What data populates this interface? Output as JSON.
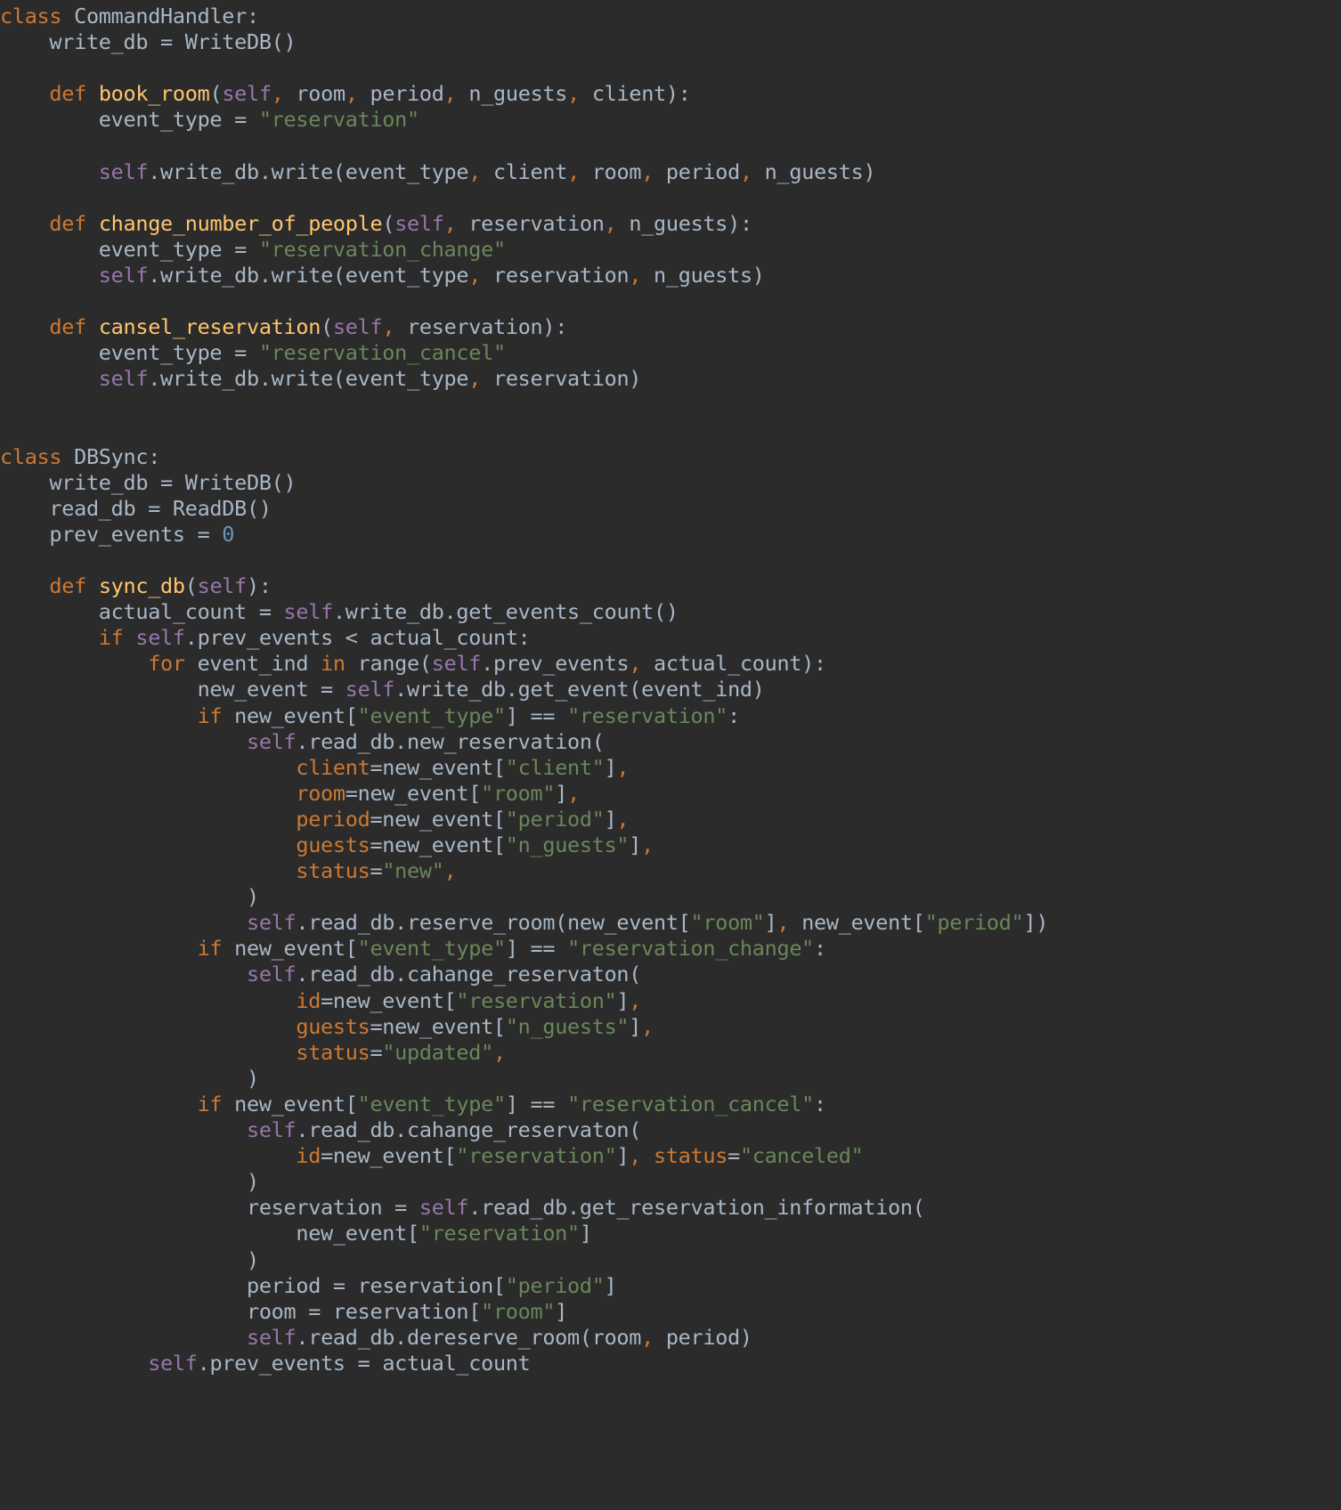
{
  "view": {
    "kind": "code-snippet",
    "language": "Python",
    "background": "#2b2b2b",
    "foreground": "#a9b7c6"
  },
  "theme": {
    "keyword": "#cc7832",
    "function": "#ffc66d",
    "self": "#9876aa",
    "string": "#6a8759",
    "number": "#6897bb",
    "default": "#a9b7c6"
  },
  "code": {
    "text": "class CommandHandler:\n    write_db = WriteDB()\n\n    def book_room(self, room, period, n_guests, client):\n        event_type = \"reservation\"\n\n        self.write_db.write(event_type, client, room, period, n_guests)\n\n    def change_number_of_people(self, reservation, n_guests):\n        event_type = \"reservation_change\"\n        self.write_db.write(event_type, reservation, n_guests)\n\n    def cansel_reservation(self, reservation):\n        event_type = \"reservation_cancel\"\n        self.write_db.write(event_type, reservation)\n\n\nclass DBSync:\n    write_db = WriteDB()\n    read_db = ReadDB()\n    prev_events = 0\n\n    def sync_db(self):\n        actual_count = self.write_db.get_events_count()\n        if self.prev_events < actual_count:\n            for event_ind in range(self.prev_events, actual_count):\n                new_event = self.write_db.get_event(event_ind)\n                if new_event[\"event_type\"] == \"reservation\":\n                    self.read_db.new_reservation(\n                        client=new_event[\"client\"],\n                        room=new_event[\"room\"],\n                        period=new_event[\"period\"],\n                        guests=new_event[\"n_guests\"],\n                        status=\"new\",\n                    )\n                    self.read_db.reserve_room(new_event[\"room\"], new_event[\"period\"])\n                if new_event[\"event_type\"] == \"reservation_change\":\n                    self.read_db.cahange_reservaton(\n                        id=new_event[\"reservation\"],\n                        guests=new_event[\"n_guests\"],\n                        status=\"updated\",\n                    )\n                if new_event[\"event_type\"] == \"reservation_cancel\":\n                    self.read_db.cahange_reservaton(\n                        id=new_event[\"reservation\"], status=\"canceled\"\n                    )\n                    reservation = self.read_db.get_reservation_information(\n                        new_event[\"reservation\"]\n                    )\n                    period = reservation[\"period\"]\n                    room = reservation[\"room\"]\n                    self.read_db.dereserve_room(room, period)\n            self.prev_events = actual_count",
    "classes": [
      "CommandHandler",
      "DBSync"
    ],
    "methods": [
      "book_room",
      "change_number_of_people",
      "cansel_reservation",
      "sync_db"
    ],
    "attributes": [
      "write_db",
      "read_db",
      "prev_events"
    ],
    "constructors": [
      "WriteDB()",
      "ReadDB()"
    ],
    "string_literals": [
      "reservation",
      "reservation_change",
      "reservation_cancel",
      "event_type",
      "client",
      "room",
      "period",
      "n_guests",
      "new",
      "updated",
      "canceled"
    ],
    "keywords": [
      "class",
      "def",
      "if",
      "for",
      "in"
    ],
    "keyword_arguments": [
      "client",
      "room",
      "period",
      "guests",
      "status",
      "id"
    ],
    "numbers": [
      "0"
    ],
    "line_count": 52
  }
}
